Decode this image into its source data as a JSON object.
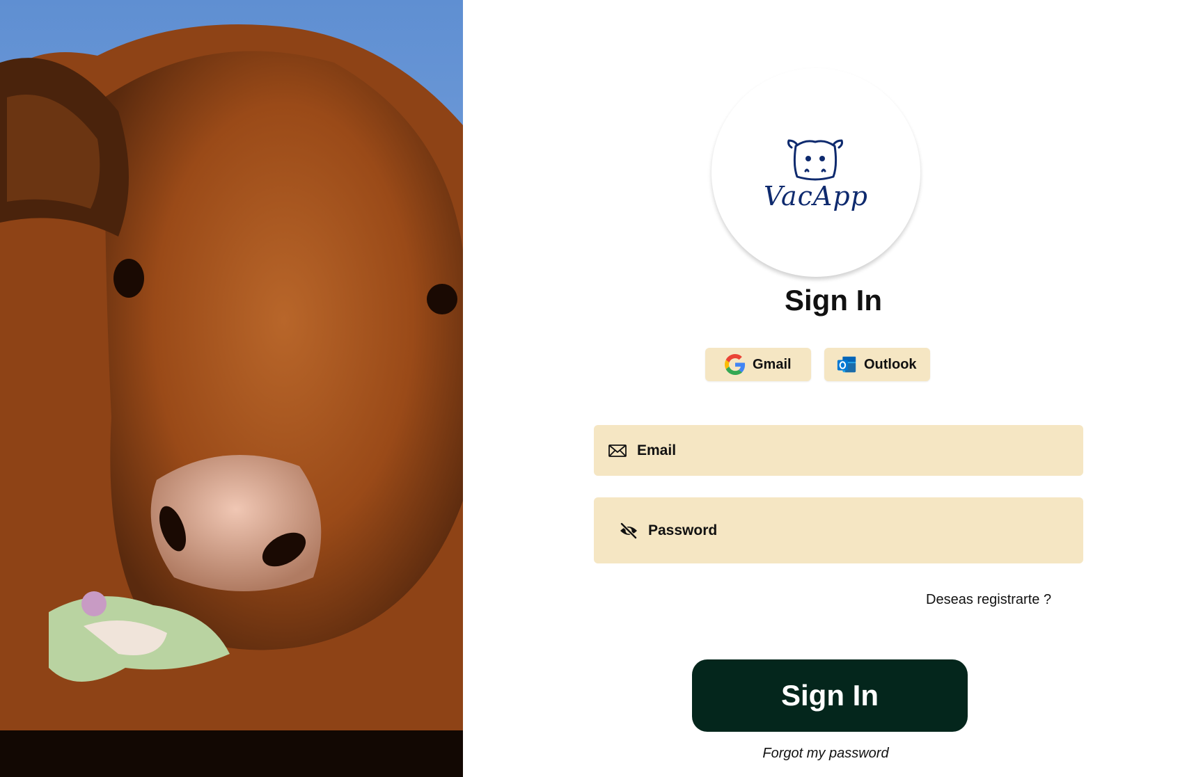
{
  "brand": {
    "logo_text": "VacApp",
    "logo_color": "#0e2a6e"
  },
  "hero_image": {
    "subject": "cow-photo",
    "colors": {
      "sky": "#6f9ad8",
      "fur": "#a9541f",
      "fur_dark": "#5a2a0e",
      "nose": "#d9a08c"
    }
  },
  "form": {
    "title": "Sign In",
    "oauth": [
      {
        "label": "Gmail",
        "icon": "google-icon"
      },
      {
        "label": "Outlook",
        "icon": "outlook-icon"
      }
    ],
    "email": {
      "placeholder": "Email",
      "value": "",
      "icon": "mail-icon"
    },
    "password": {
      "placeholder": "Password",
      "value": "",
      "icon": "eye-off-icon"
    },
    "register_link": "Deseas registrarte ?",
    "submit_label": "Sign In",
    "forgot_link": "Forgot my password"
  },
  "colors": {
    "field_bg": "#f5e6c3",
    "button_bg": "#04261c",
    "button_text": "#ffffff"
  }
}
